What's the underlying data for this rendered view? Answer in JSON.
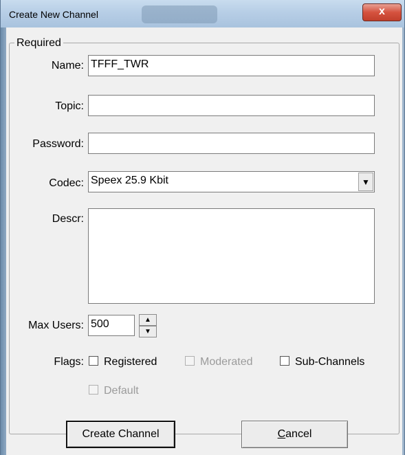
{
  "window": {
    "title": "Create New Channel",
    "close_glyph": "x"
  },
  "group": {
    "legend": "Required"
  },
  "fields": {
    "name_label": "Name:",
    "name_value": "TFFF_TWR",
    "topic_label": "Topic:",
    "topic_value": "",
    "password_label": "Password:",
    "password_value": "",
    "codec_label": "Codec:",
    "codec_value": "Speex 25.9 Kbit",
    "descr_label": "Descr:",
    "descr_value": "",
    "maxusers_label": "Max Users:",
    "maxusers_value": "500"
  },
  "flags": {
    "label": "Flags:",
    "registered": {
      "label": "Registered",
      "checked": false,
      "enabled": true
    },
    "moderated": {
      "label": "Moderated",
      "checked": false,
      "enabled": false
    },
    "subchannels": {
      "label": "Sub-Channels",
      "checked": false,
      "enabled": true
    },
    "default": {
      "label": "Default",
      "checked": false,
      "enabled": false
    }
  },
  "buttons": {
    "create": "Create Channel",
    "cancel_mnemonic": "C",
    "cancel_rest": "ancel"
  },
  "icons": {
    "combo_arrow": "chevron-down-icon",
    "spin_up": "spin-up-icon",
    "spin_down": "spin-down-icon",
    "close": "close-icon"
  }
}
